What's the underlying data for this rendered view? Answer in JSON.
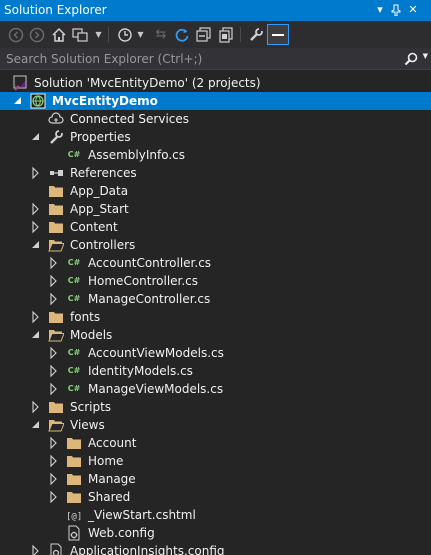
{
  "window": {
    "title": "Solution Explorer",
    "pin_icon": "pin-icon",
    "dropdown_icon": "window-dropdown-icon",
    "close_icon": "close-icon"
  },
  "toolbar": {
    "items": [
      "back-icon",
      "forward-icon",
      "home-icon",
      "switch-views-icon",
      "pending-changes-filter-icon",
      "sync-icon",
      "refresh-icon",
      "collapse-all-icon",
      "show-all-files-icon",
      "properties-icon",
      "preview-selected-icon"
    ]
  },
  "search": {
    "placeholder": "Search Solution Explorer (Ctrl+;)"
  },
  "tree": {
    "solution": "Solution 'MvcEntityDemo' (2 projects)",
    "project": "MvcEntityDemo",
    "connected_services": "Connected Services",
    "properties": "Properties",
    "assembly_info": "AssemblyInfo.cs",
    "references": "References",
    "app_data": "App_Data",
    "app_start": "App_Start",
    "content": "Content",
    "controllers": "Controllers",
    "account_controller": "AccountController.cs",
    "home_controller": "HomeController.cs",
    "manage_controller": "ManageController.cs",
    "fonts": "fonts",
    "models": "Models",
    "account_view_models": "AccountViewModels.cs",
    "identity_models": "IdentityModels.cs",
    "manage_view_models": "ManageViewModels.cs",
    "scripts": "Scripts",
    "views": "Views",
    "views_account": "Account",
    "views_home": "Home",
    "views_manage": "Manage",
    "views_shared": "Shared",
    "viewstart": "_ViewStart.cshtml",
    "web_config_views": "Web.config",
    "app_insights": "ApplicationInsights.config"
  },
  "colors": {
    "accent": "#007acc",
    "background": "#252526",
    "folder": "#dcb67a",
    "csharp": "#87d37c"
  }
}
